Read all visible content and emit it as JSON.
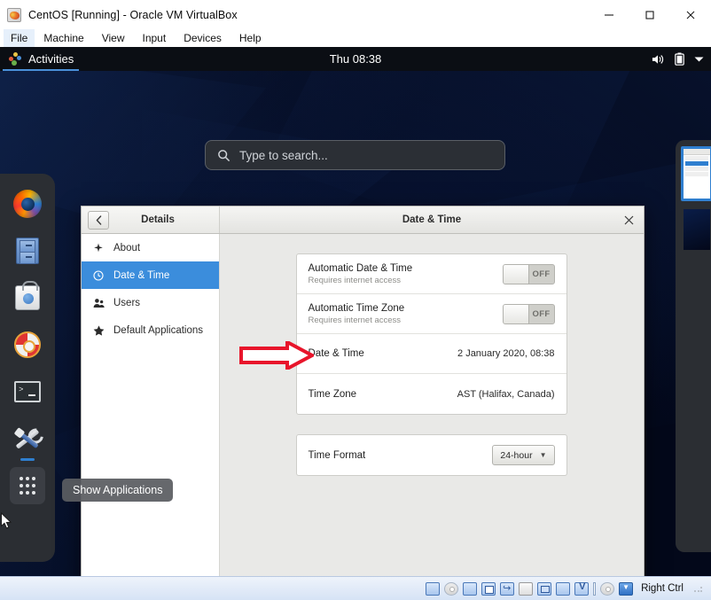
{
  "host_window": {
    "title": "CentOS [Running] - Oracle VM VirtualBox",
    "app_icon": "virtualbox-icon",
    "menus": [
      "File",
      "Machine",
      "View",
      "Input",
      "Devices",
      "Help"
    ],
    "controls": {
      "minimize": "minimize-icon",
      "maximize": "maximize-icon",
      "close": "close-icon"
    }
  },
  "guest": {
    "topbar": {
      "activities": "Activities",
      "clock": "Thu 08:38",
      "indicators": [
        "volume-icon",
        "battery-icon",
        "chevron-down-icon"
      ]
    },
    "search": {
      "placeholder": "Type to search...",
      "value": "",
      "icon": "search-icon"
    },
    "dock": {
      "items": [
        {
          "name": "firefox",
          "label": "Firefox",
          "running": false
        },
        {
          "name": "files",
          "label": "Files",
          "running": false
        },
        {
          "name": "software",
          "label": "Software",
          "running": false
        },
        {
          "name": "help",
          "label": "Help",
          "running": false
        },
        {
          "name": "terminal",
          "label": "Terminal",
          "running": false
        },
        {
          "name": "settings",
          "label": "Settings",
          "running": true
        }
      ],
      "show_applications": "show-applications-icon"
    },
    "tooltip": "Show Applications",
    "workspace_strip": {
      "thumbnails": 2
    }
  },
  "settings_window": {
    "headerbar": {
      "back_icon": "chevron-left-icon",
      "sidebar_title": "Details",
      "title": "Date & Time",
      "close_icon": "close-icon"
    },
    "sidebar": {
      "items": [
        {
          "label": "About",
          "icon": "about-icon",
          "active": false
        },
        {
          "label": "Date & Time",
          "icon": "clock-icon",
          "active": true
        },
        {
          "label": "Users",
          "icon": "users-icon",
          "active": false
        },
        {
          "label": "Default Applications",
          "icon": "star-icon",
          "active": false
        }
      ]
    },
    "panels": [
      {
        "rows": [
          {
            "label": "Automatic Date & Time",
            "sublabel": "Requires internet access",
            "control": "toggle",
            "state": "OFF"
          },
          {
            "label": "Automatic Time Zone",
            "sublabel": "Requires internet access",
            "control": "toggle",
            "state": "OFF"
          },
          {
            "label": "Date & Time",
            "sublabel": "",
            "control": "value",
            "value": "2 January 2020, 08:38"
          },
          {
            "label": "Time Zone",
            "sublabel": "",
            "control": "value",
            "value": "AST (Halifax, Canada)"
          }
        ]
      },
      {
        "rows": [
          {
            "label": "Time Format",
            "sublabel": "",
            "control": "combo",
            "value": "24-hour"
          }
        ]
      }
    ]
  },
  "annotation": {
    "arrow": "red-right-arrow",
    "color": "#e8152b",
    "points_at": "Date & Time"
  },
  "status_bar": {
    "host_key": "Right Ctrl",
    "icons": [
      "hard-disk-icon",
      "optical-disk-icon",
      "floppy-icon",
      "network-icon",
      "usb-icon",
      "shared-folder-icon",
      "display-icon",
      "recording-icon",
      "vm-icon",
      "mouse-icon",
      "keyboard-icon"
    ]
  },
  "colors": {
    "accent_blue": "#3b8ddc",
    "topbar": "#0b0e14",
    "dock": "#2b2e33",
    "window_bg": "#e9e9e7",
    "sidebar_bg": "#ffffff",
    "arrow_red": "#e8152b"
  }
}
